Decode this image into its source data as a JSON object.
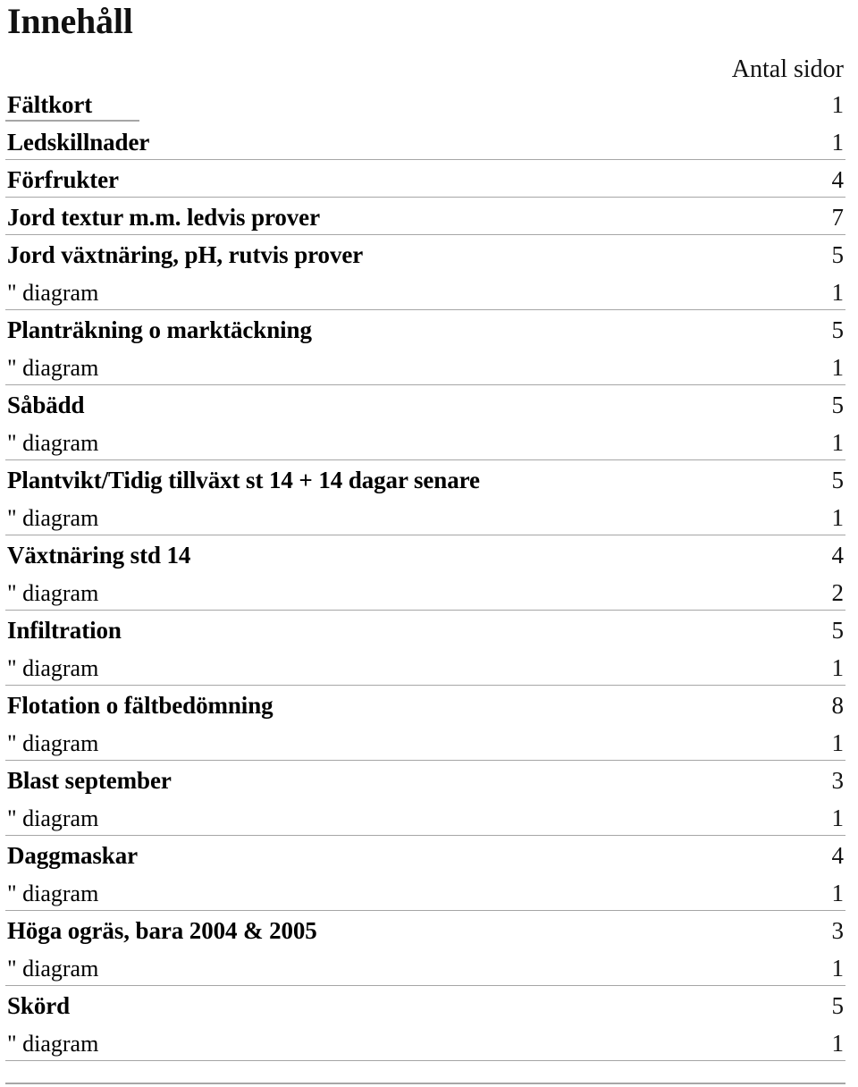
{
  "document": {
    "title": "Innehåll",
    "column_header": "Antal sidor",
    "rule_color": "#a6a6a6"
  },
  "toc": {
    "rows": [
      {
        "label": "Fältkort",
        "pages": "1",
        "level": "major",
        "rule": "short"
      },
      {
        "label": "Ledskillnader",
        "pages": "1",
        "level": "major",
        "rule": "full"
      },
      {
        "label": "Förfrukter",
        "pages": "4",
        "level": "major",
        "rule": "full"
      },
      {
        "label": "Jord textur m.m. ledvis prover",
        "pages": "7",
        "level": "major",
        "rule": "full"
      },
      {
        "label": "Jord växtnäring, pH,  rutvis prover",
        "pages": "5",
        "level": "major",
        "rule": "none"
      },
      {
        "label": "\" diagram",
        "pages": "1",
        "level": "sub",
        "rule": "full"
      },
      {
        "label": "Planträkning o marktäckning",
        "pages": "5",
        "level": "major",
        "rule": "none"
      },
      {
        "label": "\" diagram",
        "pages": "1",
        "level": "sub",
        "rule": "full"
      },
      {
        "label": "Såbädd",
        "pages": "5",
        "level": "major",
        "rule": "none"
      },
      {
        "label": "\" diagram",
        "pages": "1",
        "level": "sub",
        "rule": "full"
      },
      {
        "label": "Plantvikt/Tidig tillväxt st 14 + 14 dagar senare",
        "pages": "5",
        "level": "major",
        "rule": "none"
      },
      {
        "label": "\" diagram",
        "pages": "1",
        "level": "sub",
        "rule": "full"
      },
      {
        "label": "Växtnäring std 14",
        "pages": "4",
        "level": "major",
        "rule": "none"
      },
      {
        "label": "\" diagram",
        "pages": "2",
        "level": "sub",
        "rule": "full"
      },
      {
        "label": "Infiltration",
        "pages": "5",
        "level": "major",
        "rule": "none"
      },
      {
        "label": "\" diagram",
        "pages": "1",
        "level": "sub",
        "rule": "full"
      },
      {
        "label": "Flotation o fältbedömning",
        "pages": "8",
        "level": "major",
        "rule": "none"
      },
      {
        "label": "\" diagram",
        "pages": "1",
        "level": "sub",
        "rule": "full"
      },
      {
        "label": "Blast september",
        "pages": "3",
        "level": "major",
        "rule": "none"
      },
      {
        "label": "\" diagram",
        "pages": "1",
        "level": "sub",
        "rule": "full"
      },
      {
        "label": "Daggmaskar",
        "pages": "4",
        "level": "major",
        "rule": "none"
      },
      {
        "label": "\" diagram",
        "pages": "1",
        "level": "sub",
        "rule": "full"
      },
      {
        "label": "Höga ogräs, bara 2004 & 2005",
        "pages": "3",
        "level": "major",
        "rule": "none"
      },
      {
        "label": "\" diagram",
        "pages": "1",
        "level": "sub",
        "rule": "full"
      },
      {
        "label": "Skörd",
        "pages": "5",
        "level": "major",
        "rule": "none"
      },
      {
        "label": "\" diagram",
        "pages": "1",
        "level": "sub",
        "rule": "full"
      }
    ]
  }
}
